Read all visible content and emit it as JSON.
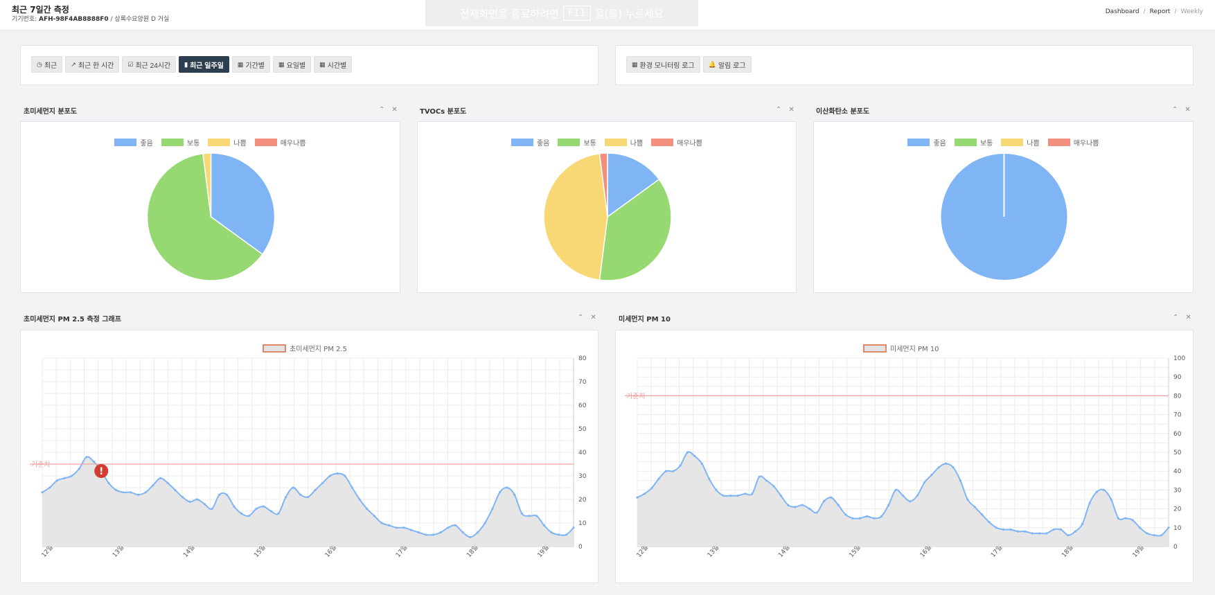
{
  "header": {
    "title": "최근 7일간 측정",
    "device_label": "기기번호:",
    "device_id": "AFH-98F4AB8888F0",
    "location": "/ 상록수요양원 D 거실",
    "fullscreen_pre": "전체화면을 종료하려면",
    "fullscreen_key": "F11",
    "fullscreen_post": "을(를) 누르세요",
    "breadcrumb": [
      "Dashboard",
      "Report",
      "Weekly"
    ]
  },
  "toolbar_left": [
    {
      "icon": "clock-icon",
      "glyph": "◷",
      "label": "최근"
    },
    {
      "icon": "trend-icon",
      "glyph": "↗",
      "label": "최근 한 시간"
    },
    {
      "icon": "calendar-check-icon",
      "glyph": "☑",
      "label": "최근 24시간"
    },
    {
      "icon": "bar-chart-icon",
      "glyph": "▮",
      "label": "최근 일주일",
      "active": true
    },
    {
      "icon": "table-icon",
      "glyph": "▦",
      "label": "기간별"
    },
    {
      "icon": "table-icon",
      "glyph": "▦",
      "label": "요일별"
    },
    {
      "icon": "table-icon",
      "glyph": "▦",
      "label": "시간별"
    }
  ],
  "toolbar_right": [
    {
      "icon": "table-icon",
      "glyph": "▦",
      "label": "환경 모니터링 로그"
    },
    {
      "icon": "bell-icon",
      "glyph": "🔔",
      "label": "알림 로그"
    }
  ],
  "legend_labels": [
    "좋음",
    "보통",
    "나쁨",
    "매우나쁨"
  ],
  "colors": {
    "good": "#7fb5f4",
    "normal": "#96d973",
    "bad": "#f8d775",
    "very_bad": "#f28f7e",
    "line": "#7fb5f4",
    "area": "#e3e3e3",
    "threshold": "#f4a0a0",
    "alert": "#d23d30",
    "active_btn": "#2d3e50"
  },
  "pie_charts": [
    {
      "title": "초미세먼지 분포도",
      "chart_data": {
        "type": "pie",
        "labels": [
          "좋음",
          "보통",
          "나쁨",
          "매우나쁨"
        ],
        "values": [
          35,
          63,
          2,
          0
        ]
      }
    },
    {
      "title": "TVOCs 분포도",
      "chart_data": {
        "type": "pie",
        "labels": [
          "좋음",
          "보통",
          "나쁨",
          "매우나쁨"
        ],
        "values": [
          15,
          37,
          46,
          2
        ]
      }
    },
    {
      "title": "이산화탄소 분포도",
      "chart_data": {
        "type": "pie",
        "labels": [
          "좋음",
          "보통",
          "나쁨",
          "매우나쁨"
        ],
        "values": [
          100,
          0,
          0,
          0
        ]
      }
    }
  ],
  "line_charts": [
    {
      "title": "초미세먼지 PM 2.5 측정 그래프",
      "chart_data": {
        "type": "area",
        "series": [
          {
            "name": "초미세먼지 PM 2.5",
            "values": [
              23,
              25,
              28,
              29,
              30,
              33,
              38,
              36,
              32,
              27,
              24,
              23,
              23,
              22,
              23,
              26,
              29,
              27,
              24,
              21,
              19,
              20,
              18,
              16,
              22,
              22,
              17,
              14,
              13,
              16,
              17,
              15,
              14,
              21,
              25,
              22,
              21,
              24,
              27,
              30,
              31,
              30,
              25,
              20,
              16,
              13,
              10,
              9,
              8,
              8,
              7,
              6,
              5,
              5,
              6,
              8,
              9,
              6,
              4,
              6,
              10,
              16,
              23,
              25,
              22,
              14,
              13,
              13,
              9,
              6,
              5,
              5,
              8
            ]
          }
        ],
        "x_ticks": [
          "12일",
          "13일",
          "14일",
          "15일",
          "16일",
          "17일",
          "18일",
          "19일"
        ],
        "y_ticks": [
          "0",
          "10",
          "20",
          "30",
          "40",
          "50",
          "60",
          "70",
          "80"
        ],
        "ylim": [
          0,
          80
        ],
        "threshold": {
          "label": "기준치",
          "value": 35
        },
        "alert_marker": {
          "glyph": "!",
          "x_index": 8
        }
      }
    },
    {
      "title": "미세먼지 PM 10",
      "chart_data": {
        "type": "area",
        "series": [
          {
            "name": "미세먼지 PM 10",
            "values": [
              26,
              28,
              31,
              36,
              40,
              40,
              43,
              50,
              48,
              44,
              36,
              30,
              27,
              27,
              27,
              28,
              28,
              37,
              35,
              32,
              27,
              22,
              21,
              22,
              20,
              18,
              24,
              26,
              22,
              17,
              15,
              15,
              16,
              15,
              16,
              22,
              30,
              27,
              24,
              27,
              34,
              38,
              42,
              44,
              42,
              35,
              25,
              21,
              17,
              13,
              10,
              9,
              9,
              8,
              8,
              7,
              7,
              7,
              9,
              9,
              6,
              8,
              12,
              23,
              29,
              30,
              25,
              15,
              15,
              14,
              10,
              7,
              6,
              6,
              10
            ]
          }
        ],
        "x_ticks": [
          "12일",
          "13일",
          "14일",
          "15일",
          "16일",
          "17일",
          "18일",
          "19일"
        ],
        "y_ticks": [
          "0",
          "10",
          "20",
          "30",
          "40",
          "50",
          "60",
          "70",
          "80",
          "90",
          "100"
        ],
        "ylim": [
          0,
          100
        ],
        "threshold": {
          "label": "기준치",
          "value": 80
        }
      }
    }
  ],
  "panel_controls": {
    "collapse": "⌃",
    "close": "✕"
  }
}
